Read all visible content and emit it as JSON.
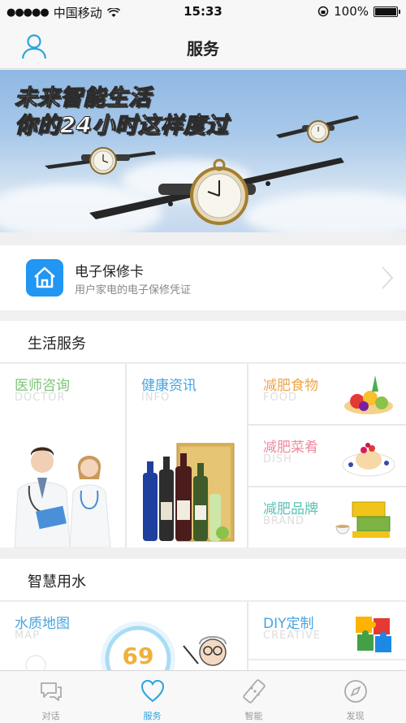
{
  "status_bar": {
    "carrier": "中国移动",
    "time": "15:33",
    "battery_text": "100%",
    "battery_level": 1.0
  },
  "nav": {
    "title": "服务",
    "user_icon": "user-icon"
  },
  "banner": {
    "line1": "未来智能生活",
    "line2": "你的24小时这样度过"
  },
  "warranty": {
    "title": "电子保修卡",
    "subtitle": "用户家电的电子保修凭证",
    "icon": "home-icon"
  },
  "life_services": {
    "title": "生活服务",
    "doctor": {
      "cn": "医师咨询",
      "en": "DOCTOR"
    },
    "info": {
      "cn": "健康资讯",
      "en": "INFO"
    },
    "food": {
      "cn": "减肥食物",
      "en": "FOOD"
    },
    "dish": {
      "cn": "减肥菜肴",
      "en": "DISH"
    },
    "brand": {
      "cn": "减肥品牌",
      "en": "BRAND"
    }
  },
  "smart_water": {
    "title": "智慧用水",
    "map": {
      "cn": "水质地图",
      "en": "MAP"
    },
    "gauge_value": "69",
    "diy": {
      "cn": "DIY定制",
      "en": "CREATIVE"
    }
  },
  "tabs": [
    {
      "label": "对话",
      "icon": "chat-bubbles-icon",
      "active": false
    },
    {
      "label": "服务",
      "icon": "heart-icon",
      "active": true
    },
    {
      "label": "智能",
      "icon": "remote-control-icon",
      "active": false
    },
    {
      "label": "发现",
      "icon": "compass-icon",
      "active": false
    }
  ],
  "colors": {
    "accent": "#2aa3e0",
    "warranty_icon_bg": "#2196f3"
  }
}
